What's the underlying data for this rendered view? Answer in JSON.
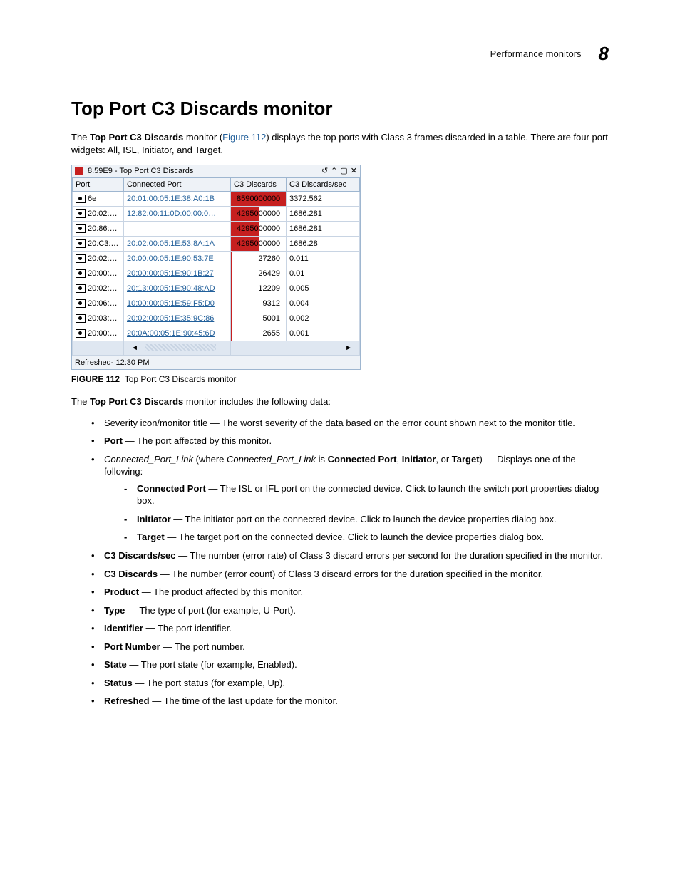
{
  "header": {
    "running_title": "Performance monitors",
    "chapter_number": "8"
  },
  "section": {
    "title": "Top Port C3 Discards monitor",
    "intro_pre": "The ",
    "intro_bold1": "Top Port C3 Discards",
    "intro_mid1": " monitor (",
    "intro_link": "Figure 112",
    "intro_post": ") displays the top ports with Class 3 frames discarded in a table. There are four port widgets: All, ISL, Initiator, and Target."
  },
  "widget": {
    "title": "8.59E9 - Top Port C3 Discards",
    "icons": {
      "refresh": "↺",
      "collapse": "⌃",
      "maximize": "▢",
      "close": "✕"
    },
    "columns": {
      "port": "Port",
      "connected": "Connected Port",
      "discards": "C3 Discards",
      "rate": "C3 Discards/sec"
    },
    "rows": [
      {
        "port": "6e",
        "connected": "20:01:00:05:1E:38:A0:1B",
        "discards": "8590000000",
        "bar_pct": 100,
        "rate": "3372.562"
      },
      {
        "port": "20:02:…",
        "connected": "12:82:00:11:0D:00:00:0…",
        "discards": "4295000000",
        "bar_pct": 50,
        "rate": "1686.281"
      },
      {
        "port": "20:86:…",
        "connected": "",
        "discards": "4295000000",
        "bar_pct": 50,
        "rate": "1686.281"
      },
      {
        "port": "20:C3:…",
        "connected": "20:02:00:05:1E:53:8A:1A",
        "discards": "4295000000",
        "bar_pct": 50,
        "rate": "1686.28"
      },
      {
        "port": "20:02:…",
        "connected": "20:00:00:05:1E:90:53:7E",
        "discards": "27260",
        "bar_pct": 2,
        "rate": "0.011"
      },
      {
        "port": "20:00:…",
        "connected": "20:00:00:05:1E:90:1B:27",
        "discards": "26429",
        "bar_pct": 2,
        "rate": "0.01"
      },
      {
        "port": "20:02:…",
        "connected": "20:13:00:05:1E:90:48:AD",
        "discards": "12209",
        "bar_pct": 2,
        "rate": "0.005"
      },
      {
        "port": "20:06:…",
        "connected": "10:00:00:05:1E:59:F5:D0",
        "discards": "9312",
        "bar_pct": 2,
        "rate": "0.004"
      },
      {
        "port": "20:03:…",
        "connected": "20:02:00:05:1E:35:9C:86",
        "discards": "5001",
        "bar_pct": 2,
        "rate": "0.002"
      },
      {
        "port": "20:00:…",
        "connected": "20:0A:00:05:1E:90:45:6D",
        "discards": "2655",
        "bar_pct": 2,
        "rate": "0.001"
      }
    ],
    "footer": "Refreshed- 12:30 PM",
    "scroll_left": "◄",
    "scroll_right": "►"
  },
  "figure": {
    "label": "FIGURE 112",
    "caption": "Top Port C3 Discards monitor"
  },
  "after": {
    "lead_pre": "The ",
    "lead_bold": "Top Port C3 Discards",
    "lead_post": " monitor includes the following data:"
  },
  "bullets": {
    "b1": "Severity icon/monitor title — The worst severity of the data based on the error count shown next to the monitor title.",
    "b2_label": "Port",
    "b2_text": " — The port affected by this monitor.",
    "b3_it1": "Connected_Port_Link",
    "b3_mid1": " (where ",
    "b3_it2": "Connected_Port_Link",
    "b3_mid2": " is ",
    "b3_bold1": "Connected Port",
    "b3_mid3": ", ",
    "b3_bold2": "Initiator",
    "b3_mid4": ", or ",
    "b3_bold3": "Target",
    "b3_post": ") — Displays one of the following:",
    "d1_label": "Connected Port",
    "d1_text": " — The ISL or IFL port on the connected device. Click to launch the switch port properties dialog box.",
    "d2_label": "Initiator",
    "d2_text": " — The initiator port on the connected device. Click to launch the device properties dialog box.",
    "d3_label": "Target",
    "d3_text": " — The target port on the connected device. Click to launch the device properties dialog box.",
    "b4_label": "C3 Discards/sec",
    "b4_text": " — The number (error rate) of Class 3 discard errors per second for the duration specified in the monitor.",
    "b5_label": "C3 Discards",
    "b5_text": " — The number (error count) of Class 3 discard errors for the duration specified in the monitor.",
    "b6_label": "Product",
    "b6_text": " — The product affected by this monitor.",
    "b7_label": "Type",
    "b7_text": " — The type of port (for example, U-Port).",
    "b8_label": "Identifier",
    "b8_text": " — The port identifier.",
    "b9_label": "Port Number",
    "b9_text": " — The port number.",
    "b10_label": "State",
    "b10_text": " — The port state (for example, Enabled).",
    "b11_label": "Status",
    "b11_text": " — The port status (for example, Up).",
    "b12_label": "Refreshed",
    "b12_text": " — The time of the last update for the monitor."
  }
}
